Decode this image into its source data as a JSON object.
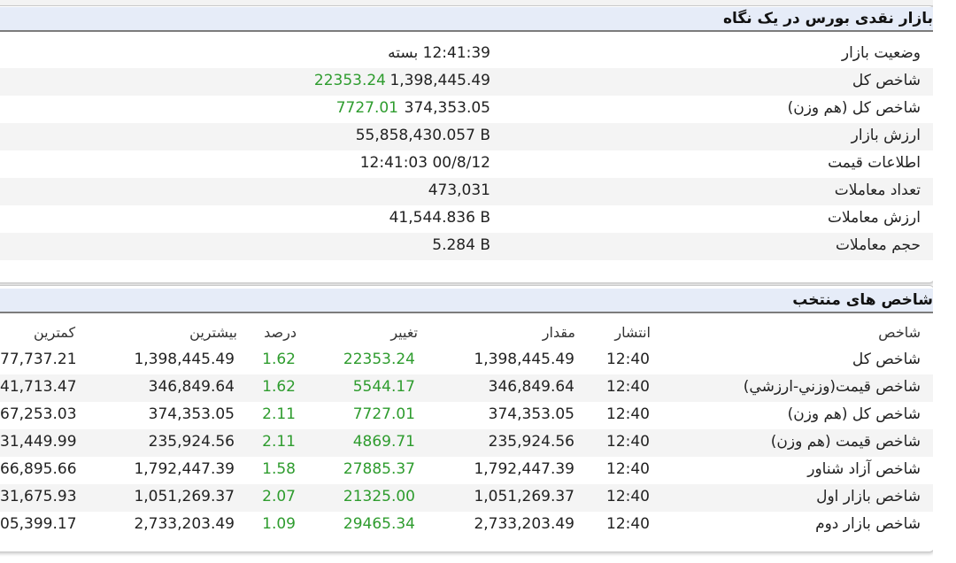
{
  "summary": {
    "title": "بازار نقدی بورس در یک نگاه",
    "rows": [
      {
        "label": "وضعیت بازار",
        "value": "12:41:39 بسته",
        "extra": ""
      },
      {
        "label": "شاخص کل",
        "value": "1,398,445.49",
        "extra": "22353.24"
      },
      {
        "label": "شاخص کل (هم وزن)",
        "value": "374,353.05",
        "extra": "7727.01"
      },
      {
        "label": "ارزش بازار",
        "value": "55,858,430.057 B",
        "extra": ""
      },
      {
        "label": "اطلاعات قیمت",
        "value": "12:41:03 00/8/12",
        "extra": ""
      },
      {
        "label": "تعداد معاملات",
        "value": "473,031",
        "extra": ""
      },
      {
        "label": "ارزش معاملات",
        "value": "41,544.836 B",
        "extra": ""
      },
      {
        "label": "حجم معاملات",
        "value": "5.284 B",
        "extra": ""
      }
    ]
  },
  "indices": {
    "title": "شاخص های منتخب",
    "columns": [
      "شاخص",
      "انتشار",
      "مقدار",
      "تغییر",
      "درصد",
      "بیشترین",
      "کمترین"
    ],
    "rows": [
      {
        "name": "شاخص کل",
        "time": "12:40",
        "amount": "1,398,445.49",
        "change": "22353.24",
        "pct": "1.62",
        "max": "1,398,445.49",
        "min": "77,737.21"
      },
      {
        "name": "شاخص قيمت(وزني-ارزشي)",
        "time": "12:40",
        "amount": "346,849.64",
        "change": "5544.17",
        "pct": "1.62",
        "max": "346,849.64",
        "min": "41,713.47"
      },
      {
        "name": "شاخص کل (هم وزن)",
        "time": "12:40",
        "amount": "374,353.05",
        "change": "7727.01",
        "pct": "2.11",
        "max": "374,353.05",
        "min": "67,253.03"
      },
      {
        "name": "شاخص قیمت (هم وزن)",
        "time": "12:40",
        "amount": "235,924.56",
        "change": "4869.71",
        "pct": "2.11",
        "max": "235,924.56",
        "min": "31,449.99"
      },
      {
        "name": "شاخص آزاد شناور",
        "time": "12:40",
        "amount": "1,792,447.39",
        "change": "27885.37",
        "pct": "1.58",
        "max": "1,792,447.39",
        "min": "66,895.66"
      },
      {
        "name": "شاخص بازار اول",
        "time": "12:40",
        "amount": "1,051,269.37",
        "change": "21325.00",
        "pct": "2.07",
        "max": "1,051,269.37",
        "min": "31,675.93"
      },
      {
        "name": "شاخص بازار دوم",
        "time": "12:40",
        "amount": "2,733,203.49",
        "change": "29465.34",
        "pct": "1.09",
        "max": "2,733,203.49",
        "min": "05,399.17"
      }
    ]
  },
  "colors": {
    "positive": "#2e9c2e",
    "header_bg": "#e6ecf8"
  }
}
